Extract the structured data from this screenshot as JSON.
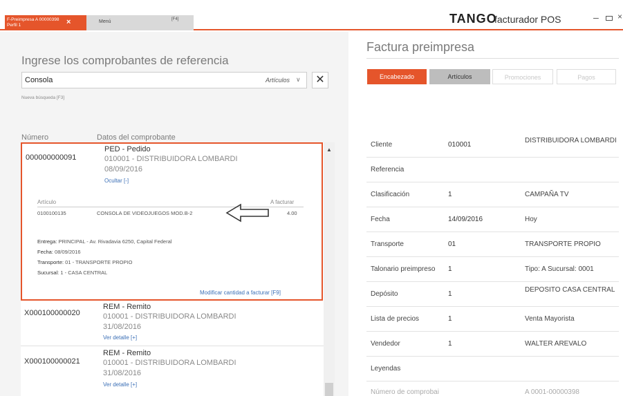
{
  "topbar": {
    "active_tab_line1": "F-Preimpresa A 00000398",
    "active_tab_line2": "Perfil 1",
    "active_tab_close": "×",
    "menu_tab_label": "Menú",
    "menu_tab_key": "[F4]",
    "logo_main": "TANGO",
    "logo_sub": "facturador POS",
    "win_min": "–",
    "win_close": "×"
  },
  "left": {
    "heading": "Ingrese los comprobantes de referencia",
    "search": {
      "value": "Consola",
      "option": "Artículos",
      "chevron": "∨",
      "clear": "✕"
    },
    "nueva_busqueda": "Nueva búsqueda [F3]",
    "col_numero": "Número",
    "col_datos": "Datos del comprobante"
  },
  "records": [
    {
      "numero": "000000000091",
      "tipo": "PED - Pedido",
      "cliente": "010001 - DISTRIBUIDORA LOMBARDI",
      "fecha": "08/09/2016",
      "link": "Ocultar [-]",
      "articulo_hdr": "Artículo",
      "afacturar_hdr": "A facturar",
      "articulo_codigo": "0100100135",
      "articulo_desc": "CONSOLA DE VIDEOJUEGOS MOD.B-2",
      "articulo_cant": "4.00",
      "entrega_lbl": "Entrega:",
      "entrega_val": "PRINCIPAL - Av. Rivadavia 6250, Capital Federal",
      "fecha_lbl": "Fecha:",
      "fecha_val": "08/09/2016",
      "transporte_lbl": "Transporte:",
      "transporte_val": "01 - TRANSPORTE PROPIO",
      "sucursal_lbl": "Sucursal:",
      "sucursal_val": "1 - CASA CENTRAL",
      "modificar": "Modificar cantidad a facturar [F9]"
    },
    {
      "numero": "X000100000020",
      "tipo": "REM - Remito",
      "cliente": "010001 - DISTRIBUIDORA LOMBARDI",
      "fecha": "31/08/2016",
      "link": "Ver detalle [+]"
    },
    {
      "numero": "X000100000021",
      "tipo": "REM - Remito",
      "cliente": "010001 - DISTRIBUIDORA LOMBARDI",
      "fecha": "31/08/2016",
      "link": "Ver detalle [+]"
    }
  ],
  "right": {
    "title": "Factura preimpresa",
    "tabs": [
      "Encabezado",
      "Artículos",
      "Promociones",
      "Pagos"
    ],
    "fields": [
      {
        "label": "Cliente",
        "code": "010001",
        "desc": "DISTRIBUIDORA LOMBARDI"
      },
      {
        "label": "Referencia",
        "code": "",
        "desc": ""
      },
      {
        "label": "Clasificación",
        "code": "1",
        "desc": "CAMPAÑA TV"
      },
      {
        "label": "Fecha",
        "code": "14/09/2016",
        "desc": "Hoy"
      },
      {
        "label": "Transporte",
        "code": "01",
        "desc": "TRANSPORTE PROPIO"
      },
      {
        "label": "Talonario preimpreso",
        "code": "1",
        "desc": "Tipo: A   Sucursal: 0001"
      },
      {
        "label": "Depósito",
        "code": "1",
        "desc": "DEPOSITO CASA CENTRAL"
      },
      {
        "label": "Lista de precios",
        "code": "1",
        "desc": "Venta Mayorista"
      },
      {
        "label": "Vendedor",
        "code": "1",
        "desc": "WALTER AREVALO"
      },
      {
        "label": "Leyendas",
        "code": "",
        "desc": ""
      },
      {
        "label": "Número de comprobai",
        "code": "",
        "desc": "A 0001-00000398"
      }
    ]
  },
  "colors": {
    "accent": "#e5552b",
    "link": "#3b6fb6"
  }
}
